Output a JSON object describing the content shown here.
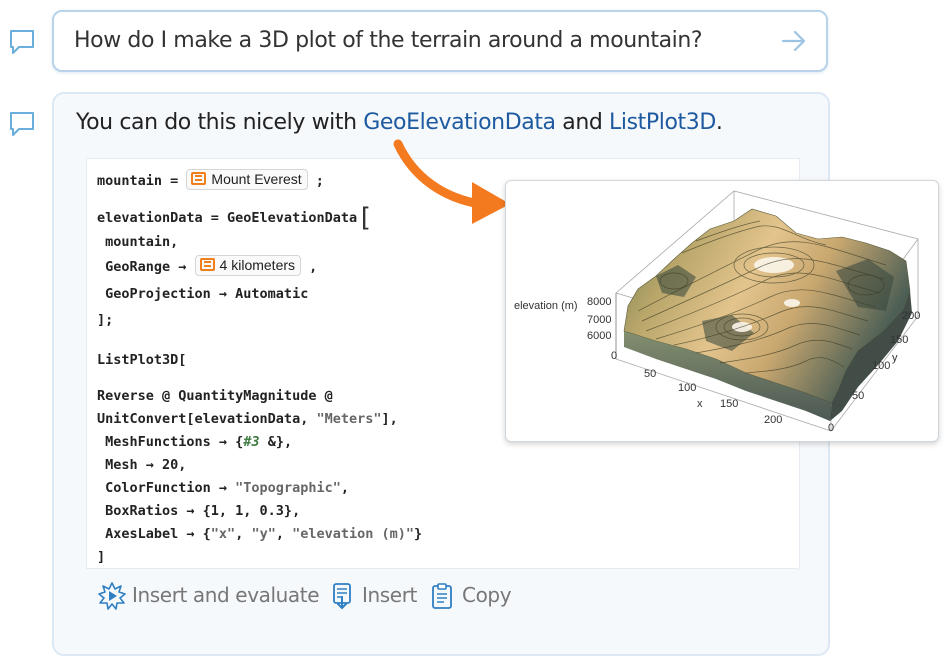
{
  "query": {
    "text": "How do I make a 3D plot of the terrain around a mountain?",
    "send_icon": "arrow-right-icon"
  },
  "answer": {
    "intro_before": "You can do this nicely with ",
    "fn1": "GeoElevationData",
    "intro_mid": " and ",
    "fn2": "ListPlot3D",
    "intro_after": "."
  },
  "code": {
    "l1_pre": "mountain = ",
    "entity1": "Mount Everest",
    "l1_post": " ;",
    "l2": "elevationData = GeoElevationData",
    "l2_bracket": "[",
    "l3": " mountain,",
    "l4_pre": " GeoRange → ",
    "entity2": "4 kilometers",
    "l4_post": " ,",
    "l5": " GeoProjection → Automatic",
    "l6": "];",
    "l7": "ListPlot3D[",
    "l8": "Reverse @ QuantityMagnitude @",
    "l9_pre": "UnitConvert[elevationData, ",
    "l9_str": "\"Meters\"",
    "l9_post": "],",
    "l10_pre": " MeshFunctions → {",
    "l10_slot": "#3",
    "l10_post": " &},",
    "l11": " Mesh → 20,",
    "l12_pre": " ColorFunction → ",
    "l12_str": "\"Topographic\"",
    "l12_post": ",",
    "l13": " BoxRatios → {1, 1, 0.3},",
    "l14_pre": " AxesLabel → {",
    "l14_s1": "\"x\"",
    "l14_c1": ", ",
    "l14_s2": "\"y\"",
    "l14_c2": ", ",
    "l14_s3": "\"elevation (m)\"",
    "l14_post": "}",
    "l15": "]"
  },
  "actions": [
    {
      "label": "Insert and evaluate",
      "icon": "evaluate-icon"
    },
    {
      "label": "Insert",
      "icon": "insert-icon"
    },
    {
      "label": "Copy",
      "icon": "clipboard-icon"
    }
  ],
  "plot": {
    "z_label": "elevation (m)",
    "z_ticks": [
      "8000",
      "7000",
      "6000"
    ],
    "x_label": "x",
    "x_ticks": [
      "0",
      "50",
      "100",
      "150",
      "200"
    ],
    "y_label": "y",
    "y_ticks": [
      "0",
      "50",
      "100",
      "150",
      "200"
    ]
  },
  "colors": {
    "accent": "#1e5aa0",
    "entity_orange": "#f07f1c",
    "pointer_orange": "#f47a20",
    "query_border": "#b8d3ea"
  }
}
